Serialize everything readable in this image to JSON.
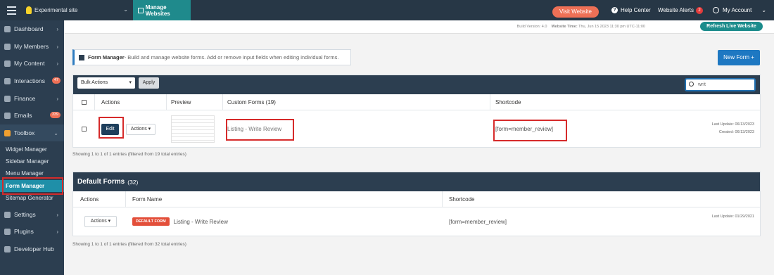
{
  "topbar": {
    "site_name": "Experimental site",
    "manage_label": "Manage Websites",
    "visit_label": "Visit Website",
    "help_label": "Help Center",
    "alerts_label": "Website Alerts",
    "alerts_count": "2",
    "account_label": "My Account"
  },
  "sidebar": {
    "items": [
      {
        "label": "Dashboard"
      },
      {
        "label": "My Members"
      },
      {
        "label": "My Content"
      },
      {
        "label": "Interactions",
        "badge": "47"
      },
      {
        "label": "Finance"
      },
      {
        "label": "Emails",
        "badge": "339"
      },
      {
        "label": "Toolbox"
      }
    ],
    "toolbox_sub": [
      {
        "label": "Widget Manager"
      },
      {
        "label": "Sidebar Manager"
      },
      {
        "label": "Menu Manager"
      },
      {
        "label": "Form Manager"
      },
      {
        "label": "Sitemap Generator"
      }
    ],
    "bottom_items": [
      {
        "label": "Settings"
      },
      {
        "label": "Plugins"
      },
      {
        "label": "Developer Hub"
      }
    ]
  },
  "buildbar": {
    "build_version": "Build Version: 4.0",
    "website_time_label": "Website Time:",
    "website_time": "Thu, Jun 15 2023 11:30 pm UTC-11:00",
    "refresh_label": "Refresh Live Website"
  },
  "info": {
    "title": "Form Manager",
    "text": " - Build and manage website forms. Add or remove input fields when editing individual forms."
  },
  "new_form_label": "New Form +",
  "custom_table": {
    "bulk_label": "Bulk Actions",
    "apply_label": "Apply",
    "search_value": "writ",
    "headers": {
      "actions": "Actions",
      "preview": "Preview",
      "custom_forms": "Custom Forms (19)",
      "shortcode": "Shortcode"
    },
    "row": {
      "edit_label": "Edit",
      "actions_label": "Actions ▾",
      "form_name": "Listing - Write Review",
      "shortcode": "[form=member_review]",
      "last_update": "Last Update: 06/13/2023",
      "created": "Created: 06/13/2023"
    },
    "showing": "Showing 1 to 1 of 1 entries (filtered from 19 total entries)"
  },
  "default_table": {
    "title": "Default Forms",
    "count": "(32)",
    "headers": {
      "actions": "Actions",
      "form_name": "Form Name",
      "shortcode": "Shortcode"
    },
    "row": {
      "actions_label": "Actions ▾",
      "tag": "DEFAULT FORM",
      "form_name": "Listing - Write Review",
      "shortcode": "[form=member_review]",
      "last_update": "Last Update: 01/29/2021"
    },
    "showing": "Showing 1 to 1 of 1 entries (filtered from 32 total entries)"
  },
  "colors": {
    "sidebar_bg": "#2c3e50",
    "accent_teal": "#1f8a8c",
    "highlight_red": "#d62b2b",
    "primary_blue": "#1e78c2"
  }
}
